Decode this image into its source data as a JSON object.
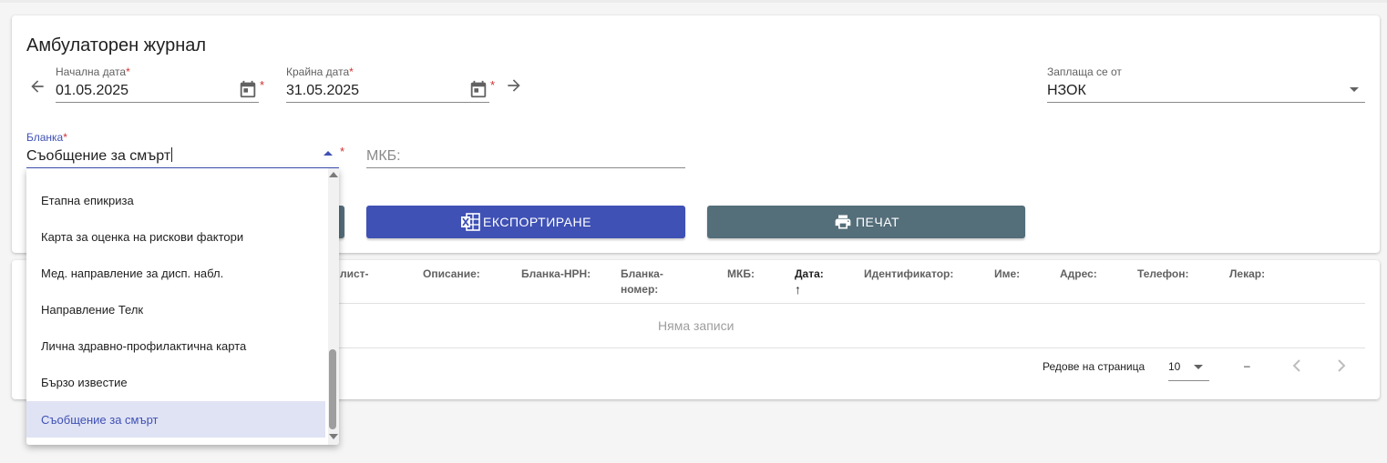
{
  "page": {
    "title": "Амбулаторен журнал"
  },
  "filters": {
    "start_date": {
      "label": "Начална дата",
      "required": "*",
      "value": "01.05.2025"
    },
    "end_date": {
      "label": "Крайна дата",
      "required": "*",
      "value": "31.05.2025"
    },
    "payer": {
      "label": "Заплаща се от",
      "value": "НЗОК"
    },
    "form": {
      "label": "Бланка",
      "required": "*",
      "value": "Съобщение за смърт"
    },
    "mkb": {
      "placeholder": "МКБ:"
    }
  },
  "buttons": {
    "export_label": "ЕКСПОРТИРАНЕ",
    "print_label": "ПЕЧАТ"
  },
  "table": {
    "headers": [
      {
        "line1": "лист-",
        "line2": ""
      },
      {
        "line1": "Описание:",
        "line2": ""
      },
      {
        "line1": "Бланка-НРН:",
        "line2": ""
      },
      {
        "line1": "Бланка-",
        "line2": "номер:"
      },
      {
        "line1": "МКБ:",
        "line2": ""
      },
      {
        "line1": "Дата:",
        "line2": "↑"
      },
      {
        "line1": "Идентификатор:",
        "line2": ""
      },
      {
        "line1": "Име:",
        "line2": ""
      },
      {
        "line1": "Адрес:",
        "line2": ""
      },
      {
        "line1": "Телефон:",
        "line2": ""
      },
      {
        "line1": "Лекар:",
        "line2": ""
      }
    ],
    "empty_text": "Няма записи"
  },
  "pager": {
    "rows_label": "Редове на страница",
    "rows_value": "10",
    "range": "–"
  },
  "dropdown": {
    "options": [
      "Етапна епикриза",
      "Карта за оценка на рискови фактори",
      "Мед. направление за дисп. набл.",
      "Направление Телк",
      "Лична здравно-профилактична карта",
      "Бързо известие",
      "Съобщение за смърт"
    ],
    "selected_index": 6
  },
  "icons": {
    "back": "arrow-left-icon",
    "forward": "arrow-right-icon",
    "calendar": "calendar-icon",
    "excel": "excel-icon",
    "printer": "printer-icon",
    "dropdown": "chevron-down-icon",
    "prev": "chevron-left-icon",
    "next": "chevron-right-icon"
  },
  "colors": {
    "primary": "#3f51b5",
    "secondary": "#546e7a",
    "required": "#d32f2f",
    "selected_bg": "#e0e3f4"
  }
}
